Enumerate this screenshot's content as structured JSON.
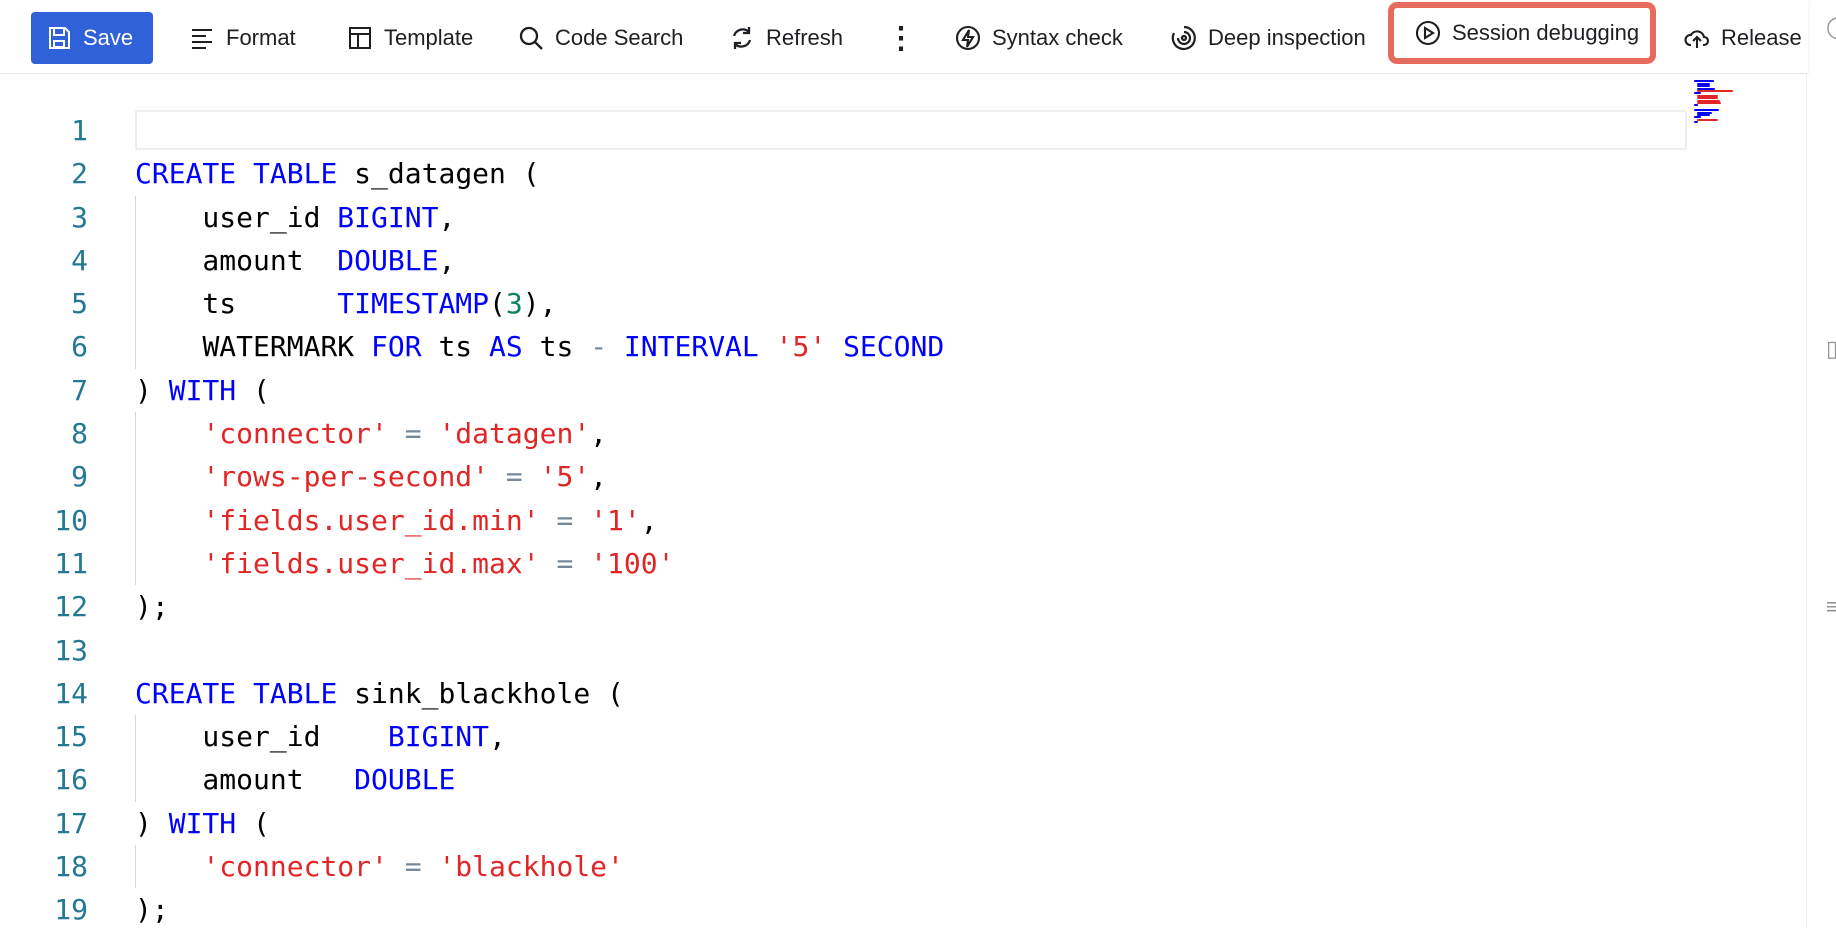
{
  "toolbar": {
    "save": "Save",
    "format": "Format",
    "template": "Template",
    "code_search": "Code Search",
    "refresh": "Refresh",
    "more": "⋮",
    "syntax_check": "Syntax check",
    "deep_inspection": "Deep inspection",
    "session_debugging": "Session debugging",
    "release": "Release",
    "highlight_color": "#e56c5d",
    "primary_color": "#2f61d8"
  },
  "editor": {
    "line_numbers": [
      "1",
      "2",
      "3",
      "4",
      "5",
      "6",
      "7",
      "8",
      "9",
      "10",
      "11",
      "12",
      "13",
      "14",
      "15",
      "16",
      "17",
      "18",
      "19"
    ],
    "lines": [
      "",
      "CREATE TABLE s_datagen (",
      "    user_id BIGINT,",
      "    amount  DOUBLE,",
      "    ts      TIMESTAMP(3),",
      "    WATERMARK FOR ts AS ts - INTERVAL '5' SECOND",
      ") WITH (",
      "    'connector' = 'datagen',",
      "    'rows-per-second' = '5',",
      "    'fields.user_id.min' = '1',",
      "    'fields.user_id.max' = '100'",
      ");",
      "",
      "CREATE TABLE sink_blackhole (",
      "    user_id    BIGINT,",
      "    amount   DOUBLE",
      ") WITH (",
      "    'connector' = 'blackhole'",
      ");"
    ],
    "colors": {
      "keyword": "#0000ff",
      "string": "#e02626",
      "number": "#098658",
      "line_number": "#237893"
    }
  },
  "icons": {
    "save": "save-icon",
    "format": "format-icon",
    "template": "template-icon",
    "code_search": "search-icon",
    "refresh": "refresh-icon",
    "syntax_check": "lightning-icon",
    "deep_inspection": "inspection-icon",
    "session_debugging": "play-circle-icon",
    "release": "upload-cloud-icon"
  }
}
